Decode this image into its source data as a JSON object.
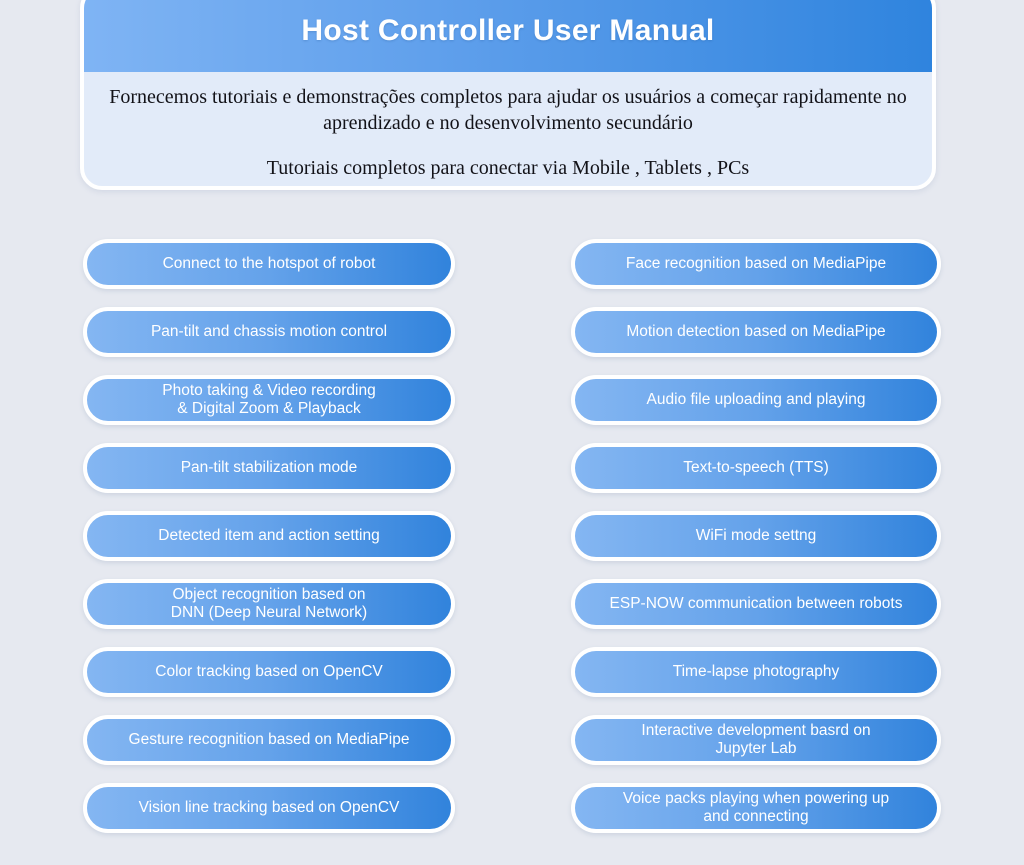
{
  "header": {
    "title": "Host Controller User Manual",
    "paragraph_1": "Fornecemos tutoriais e demonstrações completos para ajudar os usuários a começar rapidamente no aprendizado e no desenvolvimento secundário",
    "paragraph_2": "Tutoriais completos para conectar via Mobile , Tablets , PCs"
  },
  "colors": {
    "page_background": "#e6e9f0",
    "card_background": "#e2ebf9",
    "banner_gradient_start": "#7fb4f4",
    "banner_gradient_end": "#2f84de",
    "pill_gradient_start": "#84b6f2",
    "pill_gradient_end": "#3183dc",
    "pill_border": "#ffffff",
    "pill_text": "#ffffff",
    "body_text": "#121218"
  },
  "left_column": [
    {
      "label": "Connect to the hotspot of robot"
    },
    {
      "label": "Pan-tilt and chassis motion control"
    },
    {
      "label": "Photo taking & Video recording\n& Digital Zoom & Playback"
    },
    {
      "label": "Pan-tilt stabilization mode"
    },
    {
      "label": "Detected item and action setting"
    },
    {
      "label": "Object recognition based on\nDNN (Deep Neural Network)"
    },
    {
      "label": "Color tracking based on OpenCV"
    },
    {
      "label": "Gesture recognition based on MediaPipe"
    },
    {
      "label": "Vision line tracking based on OpenCV"
    }
  ],
  "right_column": [
    {
      "label": "Face recognition based on MediaPipe"
    },
    {
      "label": "Motion detection based on MediaPipe"
    },
    {
      "label": "Audio file uploading and playing"
    },
    {
      "label": "Text-to-speech (TTS)"
    },
    {
      "label": "WiFi mode settng"
    },
    {
      "label": "ESP-NOW communication between robots"
    },
    {
      "label": "Time-lapse photography"
    },
    {
      "label": "Interactive development basrd on\nJupyter Lab"
    },
    {
      "label": "Voice packs playing when powering up\nand connecting"
    }
  ]
}
